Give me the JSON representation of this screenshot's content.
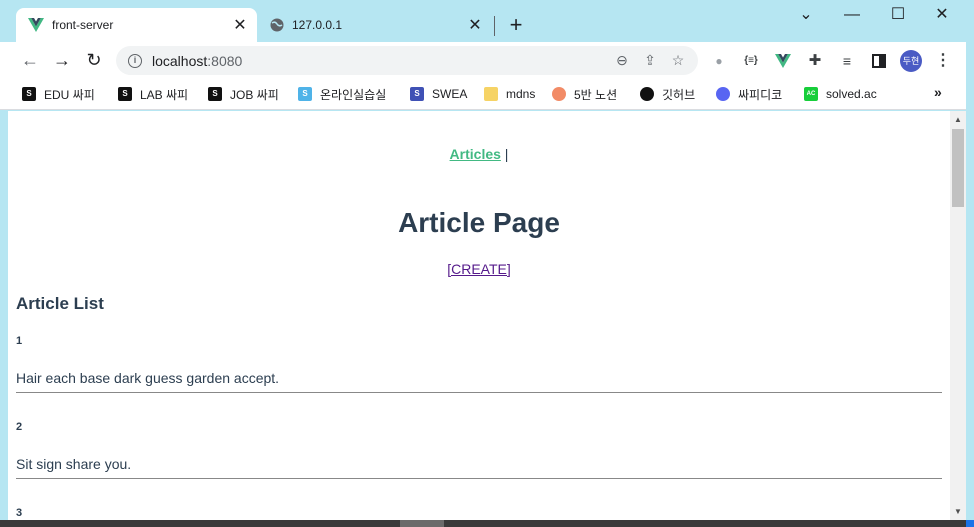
{
  "browser": {
    "tabs": [
      {
        "title": "front-server",
        "active": true,
        "icon": "vue-logo-icon"
      },
      {
        "title": "127.0.0.1",
        "active": false,
        "icon": "globe-icon"
      }
    ],
    "new_tab_label": "+",
    "window_controls": {
      "dropdown": "⌄",
      "minimize": "—",
      "maximize": "☐",
      "close": "✕"
    },
    "address": {
      "host": "localhost",
      "port": ":8080"
    },
    "profile_label": "두현",
    "bookmarks": [
      {
        "label": "EDU 싸피",
        "icon": "ssafy-icon",
        "color": "#111111"
      },
      {
        "label": "LAB 싸피",
        "icon": "ssafy-icon",
        "color": "#111111"
      },
      {
        "label": "JOB 싸피",
        "icon": "ssafy-icon",
        "color": "#111111"
      },
      {
        "label": "온라인실습실",
        "icon": "ssafy-icon",
        "color": "#4fb3e8"
      },
      {
        "label": "SWEA",
        "icon": "swea-icon",
        "color": "#3f51b5"
      },
      {
        "label": "mdns",
        "icon": "folder-icon",
        "color": "#f6d365"
      },
      {
        "label": "5반 노션",
        "icon": "peach-icon",
        "color": "#f28b66"
      },
      {
        "label": "깃허브",
        "icon": "github-icon",
        "color": "#111111"
      },
      {
        "label": "싸피디코",
        "icon": "discord-icon",
        "color": "#5865f2"
      },
      {
        "label": "solved.ac",
        "icon": "solvedac-icon",
        "color": "#17ce3a"
      }
    ],
    "bookmarks_more": "»"
  },
  "page": {
    "nav_link": "Articles",
    "nav_separator": " |",
    "heading": "Article Page",
    "create_link": "[CREATE]",
    "list_heading": "Article List",
    "articles": [
      {
        "id": "1",
        "content": "Hair each base dark guess garden accept."
      },
      {
        "id": "2",
        "content": "Sit sign share you."
      },
      {
        "id": "3",
        "content": ""
      }
    ]
  },
  "colors": {
    "accent": "#42b983",
    "text": "#2c3e50",
    "chrome": "#b6e6f2"
  }
}
